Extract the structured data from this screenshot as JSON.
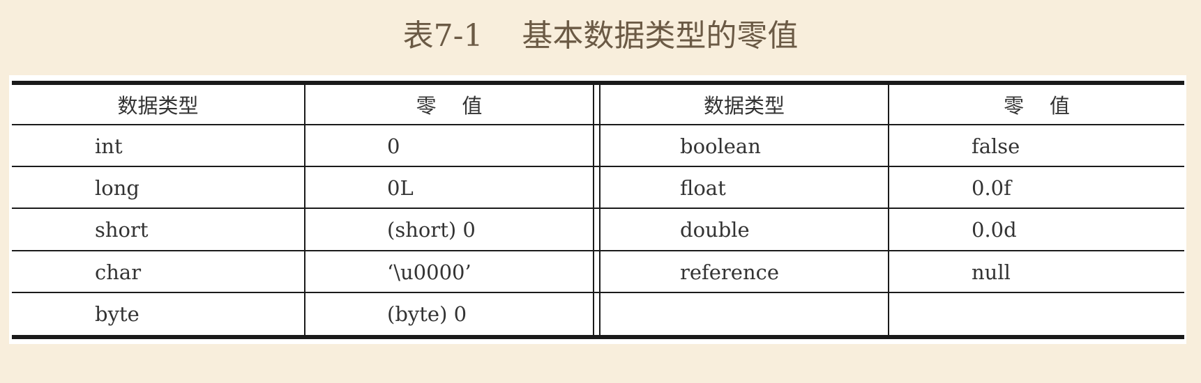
{
  "title": "表7-1    基本数据类型的零值",
  "table": {
    "headers": [
      "数据类型",
      "零    值",
      "数据类型",
      "零    值"
    ],
    "rows": [
      [
        "int",
        "0",
        "boolean",
        "false"
      ],
      [
        "long",
        "0L",
        "float",
        "0.0f"
      ],
      [
        "short",
        "(short) 0",
        "double",
        "0.0d"
      ],
      [
        "char",
        "‘\\u0000’",
        "reference",
        "null"
      ],
      [
        "byte",
        "(byte) 0",
        "",
        ""
      ]
    ]
  }
}
